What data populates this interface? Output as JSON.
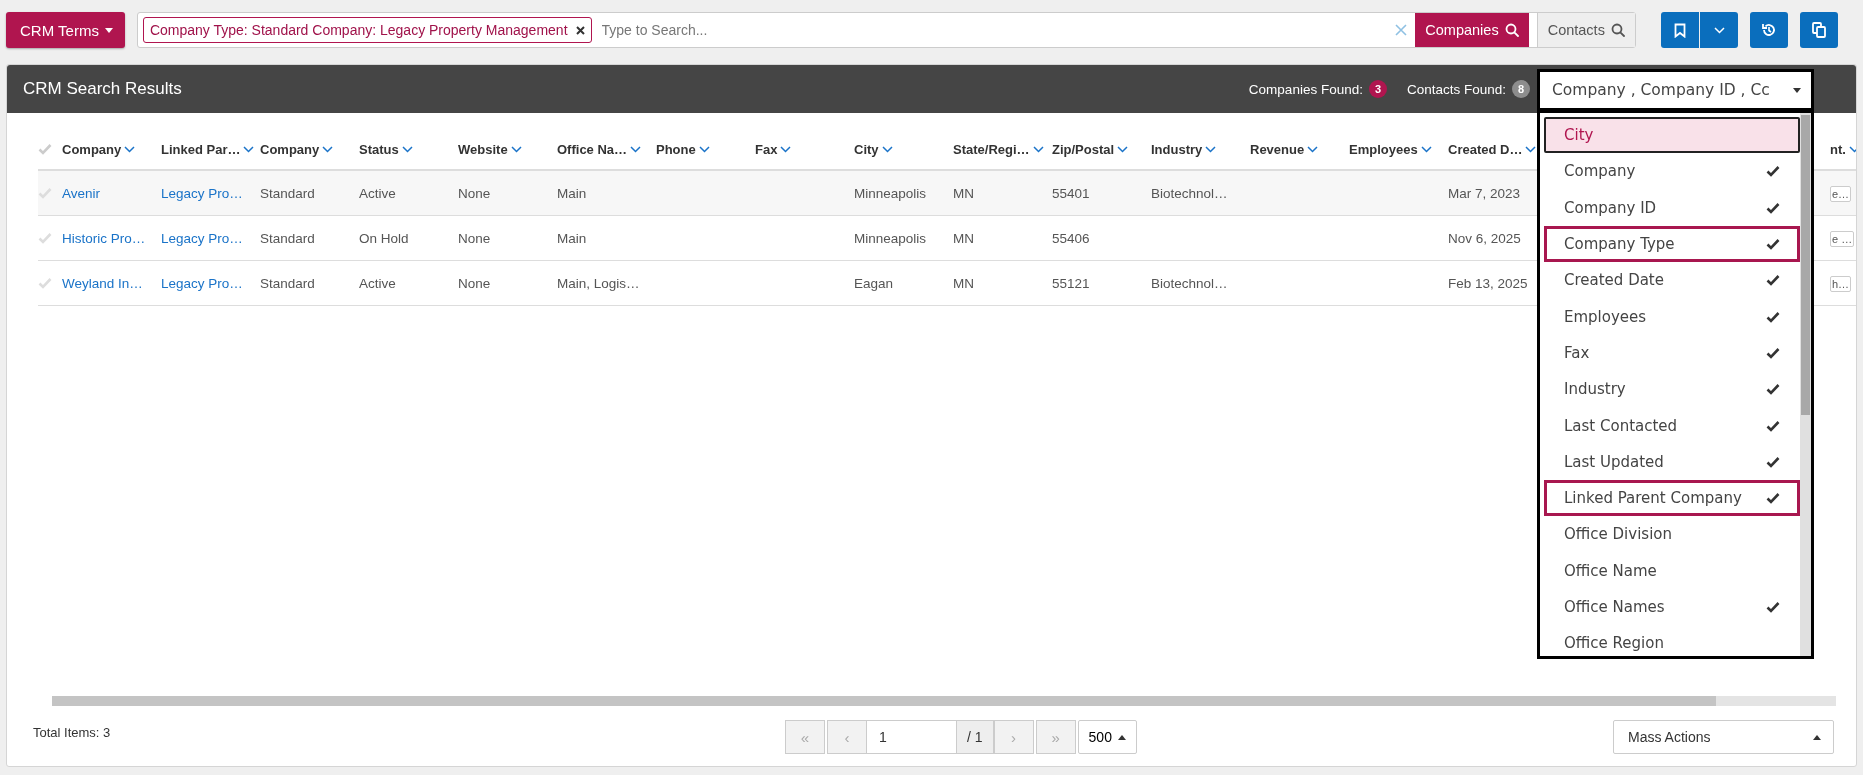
{
  "toolbar": {
    "terms_button": "CRM Terms",
    "search": {
      "tags": [
        {
          "label": "Company Type: Standard Company: Legacy Property Management"
        }
      ],
      "placeholder": "Type to Search..."
    },
    "scopes": [
      {
        "label": "Companies",
        "selected": true
      },
      {
        "label": "Contacts",
        "selected": false
      }
    ]
  },
  "results": {
    "title": "CRM Search Results",
    "counts": [
      {
        "label": "Companies Found:",
        "value": "3",
        "kind": "primary"
      },
      {
        "label": "Contacts Found:",
        "value": "8",
        "kind": "muted"
      }
    ],
    "column_picker": {
      "value": "Company , Company ID , Cc",
      "expanded": true,
      "options": [
        {
          "label": "City",
          "checked": false,
          "focused": true,
          "highlighted": false
        },
        {
          "label": "Company",
          "checked": true,
          "focused": false,
          "highlighted": false
        },
        {
          "label": "Company ID",
          "checked": true,
          "focused": false,
          "highlighted": false
        },
        {
          "label": "Company Type",
          "checked": true,
          "focused": false,
          "highlighted": true
        },
        {
          "label": "Created Date",
          "checked": true,
          "focused": false,
          "highlighted": false
        },
        {
          "label": "Employees",
          "checked": true,
          "focused": false,
          "highlighted": false
        },
        {
          "label": "Fax",
          "checked": true,
          "focused": false,
          "highlighted": false
        },
        {
          "label": "Industry",
          "checked": true,
          "focused": false,
          "highlighted": false
        },
        {
          "label": "Last Contacted",
          "checked": true,
          "focused": false,
          "highlighted": false
        },
        {
          "label": "Last Updated",
          "checked": true,
          "focused": false,
          "highlighted": false
        },
        {
          "label": "Linked Parent Company",
          "checked": true,
          "focused": false,
          "highlighted": true
        },
        {
          "label": "Office Division",
          "checked": false,
          "focused": false,
          "highlighted": false
        },
        {
          "label": "Office Name",
          "checked": false,
          "focused": false,
          "highlighted": false
        },
        {
          "label": "Office Names",
          "checked": true,
          "focused": false,
          "highlighted": false
        },
        {
          "label": "Office Region",
          "checked": false,
          "focused": false,
          "highlighted": false
        }
      ]
    }
  },
  "table": {
    "columns": [
      {
        "label": "Company",
        "kind": "link"
      },
      {
        "label": "Linked Par…",
        "kind": "link"
      },
      {
        "label": "Company",
        "kind": "text"
      },
      {
        "label": "Status",
        "kind": "text"
      },
      {
        "label": "Website",
        "kind": "text"
      },
      {
        "label": "Office Na…",
        "kind": "text"
      },
      {
        "label": "Phone",
        "kind": "text"
      },
      {
        "label": "Fax",
        "kind": "text"
      },
      {
        "label": "City",
        "kind": "text"
      },
      {
        "label": "State/Regi…",
        "kind": "text"
      },
      {
        "label": "Zip/Postal",
        "kind": "text"
      },
      {
        "label": "Industry",
        "kind": "text"
      },
      {
        "label": "Revenue",
        "kind": "text"
      },
      {
        "label": "Employees",
        "kind": "text"
      },
      {
        "label": "Created D…",
        "kind": "text"
      },
      {
        "label": "nt.",
        "kind": "boxed"
      }
    ],
    "rows": [
      {
        "cells": [
          "Avenir",
          "Legacy Pro…",
          "Standard",
          "Active",
          "None",
          "Main",
          null,
          null,
          "Minneapolis",
          "MN",
          "55401",
          "Biotechnol…",
          null,
          null,
          "Mar 7, 2023",
          "e…"
        ]
      },
      {
        "cells": [
          "Historic Pro…",
          "Legacy Pro…",
          "Standard",
          "On Hold",
          "None",
          "Main",
          null,
          null,
          "Minneapolis",
          "MN",
          "55406",
          null,
          null,
          null,
          "Nov 6, 2025",
          "e …"
        ]
      },
      {
        "cells": [
          "Weyland In…",
          "Legacy Pro…",
          "Standard",
          "Active",
          "None",
          "Main, Logis…",
          null,
          null,
          "Eagan",
          "MN",
          "55121",
          "Biotechnol…",
          null,
          null,
          "Feb 13, 2025",
          "h…"
        ]
      }
    ]
  },
  "footer": {
    "total": "Total Items: 3",
    "pager": {
      "first": "«",
      "prev": "‹",
      "page": "1",
      "of": "/ 1",
      "next": "›",
      "last": "»",
      "page_size": "500"
    },
    "mass_actions": "Mass Actions"
  }
}
